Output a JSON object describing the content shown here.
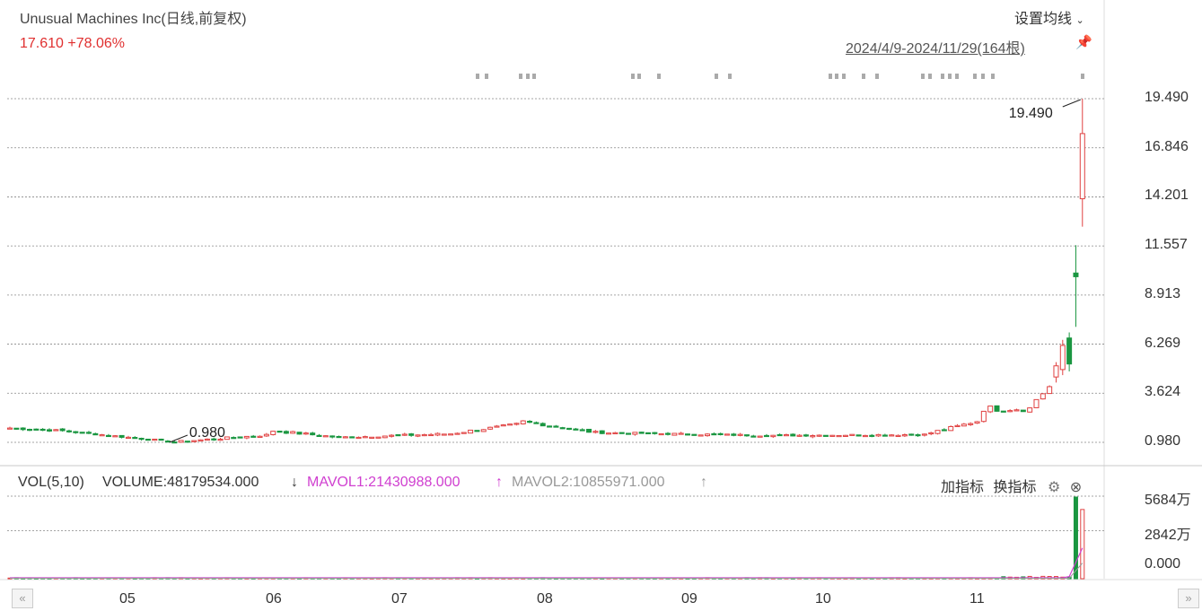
{
  "header": {
    "title": "Unusual Machines Inc(日线,前复权)",
    "price": "17.610",
    "change": "+78.06%",
    "ma_setting_label": "设置均线",
    "range_label": "2024/4/9-2024/11/29(164根)"
  },
  "volume_header": {
    "vol": "VOL(5,10)",
    "volume": "VOLUME:48179534.000",
    "volume_arrow": "↓",
    "mavol1": "MAVOL1:21430988.000",
    "mavol1_arrow": "↑",
    "mavol2": "MAVOL2:10855971.000",
    "mavol2_arrow": "↑",
    "add_indicator": "加指标",
    "change_indicator": "换指标"
  },
  "colors": {
    "up": "#e04040",
    "down": "#1a9641",
    "mavol1": "#d040d0",
    "mavol2": "#999999",
    "grid": "#888888"
  },
  "chart_data": [
    {
      "type": "candlestick",
      "title": "Unusual Machines Inc(日线,前复权)",
      "y_ticks": [
        "19.490",
        "16.846",
        "14.201",
        "11.557",
        "8.913",
        "6.269",
        "3.624",
        "0.980"
      ],
      "ylim": [
        0.98,
        19.49
      ],
      "x_ticks": [
        "05",
        "06",
        "07",
        "08",
        "09",
        "10",
        "11"
      ],
      "annotations": [
        {
          "label": "19.490",
          "value": 19.49,
          "kind": "high"
        },
        {
          "label": "0.980",
          "value": 0.98,
          "kind": "low"
        }
      ],
      "segments": [
        {
          "from": 0,
          "to": 8,
          "start": 1.75,
          "end": 1.6,
          "amp": 0.12
        },
        {
          "from": 8,
          "to": 25,
          "start": 1.6,
          "end": 1.0,
          "amp": 0.1
        },
        {
          "from": 25,
          "to": 40,
          "start": 1.0,
          "end": 1.4,
          "amp": 0.12
        },
        {
          "from": 40,
          "to": 50,
          "start": 1.6,
          "end": 1.25,
          "amp": 0.15
        },
        {
          "from": 50,
          "to": 68,
          "start": 1.25,
          "end": 1.45,
          "amp": 0.12
        },
        {
          "from": 68,
          "to": 78,
          "start": 1.5,
          "end": 2.0,
          "amp": 0.15
        },
        {
          "from": 78,
          "to": 90,
          "start": 2.1,
          "end": 1.45,
          "amp": 0.15
        },
        {
          "from": 90,
          "to": 115,
          "start": 1.5,
          "end": 1.35,
          "amp": 0.1
        },
        {
          "from": 115,
          "to": 140,
          "start": 1.35,
          "end": 1.4,
          "amp": 0.1
        },
        {
          "from": 140,
          "to": 148,
          "start": 1.5,
          "end": 2.2,
          "amp": 0.15
        },
        {
          "from": 148,
          "to": 156,
          "start": 2.8,
          "end": 2.8,
          "amp": 0.35
        },
        {
          "from": 156,
          "to": 159,
          "start": 3.3,
          "end": 4.3,
          "amp": 0.3
        }
      ],
      "last_candles": [
        {
          "o": 4.5,
          "h": 5.3,
          "l": 4.2,
          "c": 5.1
        },
        {
          "o": 4.9,
          "h": 6.5,
          "l": 4.6,
          "c": 6.2
        },
        {
          "o": 6.6,
          "h": 6.9,
          "l": 4.8,
          "c": 5.2
        },
        {
          "o": 10.1,
          "h": 11.6,
          "l": 7.2,
          "c": 9.9
        },
        {
          "o": 14.1,
          "h": 19.49,
          "l": 12.6,
          "c": 17.61
        }
      ]
    },
    {
      "type": "bar",
      "title": "VOL(5,10)",
      "y_ticks": [
        "5684万",
        "2842万",
        "0.000"
      ],
      "ylim": [
        0,
        5684
      ],
      "series": [
        {
          "name": "VOLUME",
          "last_values": [
            56840000,
            48179534
          ]
        },
        {
          "name": "MAVOL1",
          "last_value": 21430988
        },
        {
          "name": "MAVOL2",
          "last_value": 10855971
        }
      ]
    }
  ],
  "nav": {
    "prev": "«",
    "next": "»"
  }
}
